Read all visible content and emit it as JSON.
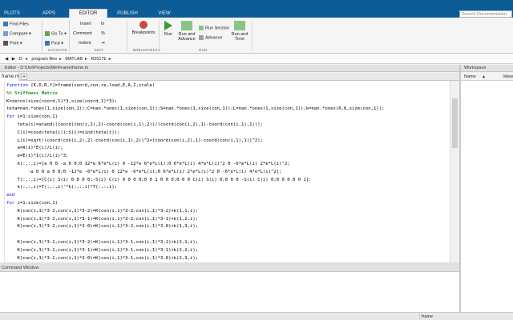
{
  "tabs": [
    "PLOTS",
    "APPS",
    "EDITOR",
    "PUBLISH",
    "VIEW"
  ],
  "active_tab": "EDITOR",
  "search_placeholder": "Search Documentation",
  "ribbon": {
    "file": {
      "find_files": "Find Files",
      "compare": "Compare",
      "print": "Print"
    },
    "navigate": {
      "goto": "Go To",
      "find": "Find",
      "section_label": "NAVIGATE"
    },
    "edit": {
      "insert": "Insert",
      "comment": "Comment",
      "indent": "Indent",
      "fx": "fx",
      "section_label": "EDIT"
    },
    "breakpoints": {
      "label": "Breakpoints",
      "section_label": "BREAKPOINTS"
    },
    "run": {
      "run": "Run",
      "run_and_advance": "Run and Advance",
      "run_section": "Run Section",
      "advance": "Advance",
      "run_and_time": "Run and Time",
      "section_label": "RUN"
    }
  },
  "address": [
    "D:",
    "program files",
    "MATLAB",
    "R2017b"
  ],
  "editor_path": "Editor - D:\\Uni\\Projects\\Me\\Frame\\frame.m",
  "editor_tab": "frame.m",
  "code_lines": [
    {
      "parts": [
        {
          "t": "function ",
          "c": "kw"
        },
        {
          "t": "[K,D,R,f]=frame(coord,con,re,load,E,A,I,scale)",
          "c": ""
        }
      ]
    },
    {
      "parts": [
        {
          "t": "%% Stiffness Matrix",
          "c": "cm"
        }
      ]
    },
    {
      "parts": [
        {
          "t": "K=zeros(size(coord,1)*3,size(coord,1)*3);",
          "c": ""
        }
      ]
    },
    {
      "parts": [
        {
          "t": "teta=nan.*ones(1,size(con,1));C=nan.*ones(1,size(con,1));S=nan.*ones(1,size(con,1));L=nan.*ones(1,size(con,1));k=nan.*ones(6,6,size(con,1));",
          "c": ""
        }
      ]
    },
    {
      "parts": [
        {
          "t": "for ",
          "c": "kw"
        },
        {
          "t": "i=1:size(con,1)",
          "c": ""
        }
      ]
    },
    {
      "parts": [
        {
          "t": "    teta(i)=atand((coord(con(i,2),2)-coord(con(i,1),2))/(coord(con(i,2),1)-coord(con(i,1),1)));",
          "c": ""
        }
      ]
    },
    {
      "parts": [
        {
          "t": "    C(i)=cosd(teta(i));S(i)=sind(teta(i));",
          "c": ""
        }
      ]
    },
    {
      "parts": [
        {
          "t": "    L(i)=sqrt((coord(con(i,2),2)-coord(con(i,1),2))^2+(coord(con(i,2),1)-coord(con(i,1),1))^2);",
          "c": ""
        }
      ]
    },
    {
      "parts": [
        {
          "t": "    a=A(i)*E(i)/L(i);",
          "c": ""
        }
      ]
    },
    {
      "parts": [
        {
          "t": "    e=E(i)*I(i)/L(i)^3;",
          "c": ""
        }
      ]
    },
    {
      "parts": [
        {
          "t": "    k(:,:,i)=[a 0 0 -a 0 0;0 12*e 6*e*L(i) 0 -12*e 6*e*L(i);0 6*e*L(i) 4*e*L(i)^2 0 -6*e*L(i) 2*e*L(i)^2;",
          "c": ""
        }
      ]
    },
    {
      "parts": [
        {
          "t": "        -a 0 0 a 0 0;0 -12*e -6*e*L(i) 0 12*e -6*e*L(i);0 6*e*L(i) 2*e*L(i)^2 0 -6*e*L(i) 4*e*L(i)^2];",
          "c": ""
        }
      ]
    },
    {
      "parts": [
        {
          "t": "    T(:,:,i)=[C(i) S(i) 0 0 0 0;-S(i) C(i) 0 0 0 0;0 0 1 0 0 0;0 0 0 C(i) S(i) 0;0 0 0 -S(i) C(i) 0;0 0 0 0 0 1];",
          "c": ""
        }
      ]
    },
    {
      "parts": [
        {
          "t": "    k(:,:,i)=T(:,:,i)'*k(:,:,i)*T(:,:,i);",
          "c": ""
        }
      ]
    },
    {
      "parts": [
        {
          "t": "end",
          "c": "kw"
        }
      ]
    },
    {
      "parts": [
        {
          "t": "for ",
          "c": "kw"
        },
        {
          "t": "i=1:size(con,1)",
          "c": ""
        }
      ]
    },
    {
      "parts": [
        {
          "t": "    K(con(i,1)*3-2,con(i,1)*3-2)=K(con(i,1)*3-2,con(i,1)*3-2)+k(1,1,i);",
          "c": ""
        }
      ]
    },
    {
      "parts": [
        {
          "t": "    K(con(i,1)*3-2,con(i,1)*3-1)=K(con(i,1)*3-2,con(i,1)*3-1)+k(1,2,i);",
          "c": ""
        }
      ]
    },
    {
      "parts": [
        {
          "t": "    K(con(i,1)*3-2,con(i,1)*3-0)=K(con(i,1)*3-2,con(i,1)*3-0)+k(1,3,i);",
          "c": ""
        }
      ]
    },
    {
      "parts": [
        {
          "t": "",
          "c": ""
        }
      ]
    },
    {
      "parts": [
        {
          "t": "    K(con(i,1)*3-1,con(i,1)*3-2)=K(con(i,1)*3-1,con(i,1)*3-2)+k(2,1,i);",
          "c": ""
        }
      ]
    },
    {
      "parts": [
        {
          "t": "    K(con(i,1)*3-1,con(i,1)*3-1)=K(con(i,1)*3-1,con(i,1)*3-1)+k(2,2,i);",
          "c": ""
        }
      ]
    },
    {
      "parts": [
        {
          "t": "    K(con(i,1)*3-1,con(i,1)*3-0)=K(con(i,1)*3-1,con(i,1)*3-0)+k(2,3,i);",
          "c": ""
        }
      ]
    }
  ],
  "command_window_title": "Command Window",
  "workspace": {
    "title": "Workspace",
    "col_name": "Name",
    "col_value": "Value"
  },
  "status_text": "frame",
  "colors": {
    "tabstrip": "#0d5c97",
    "keyword": "#0000ff",
    "comment": "#228b22"
  }
}
